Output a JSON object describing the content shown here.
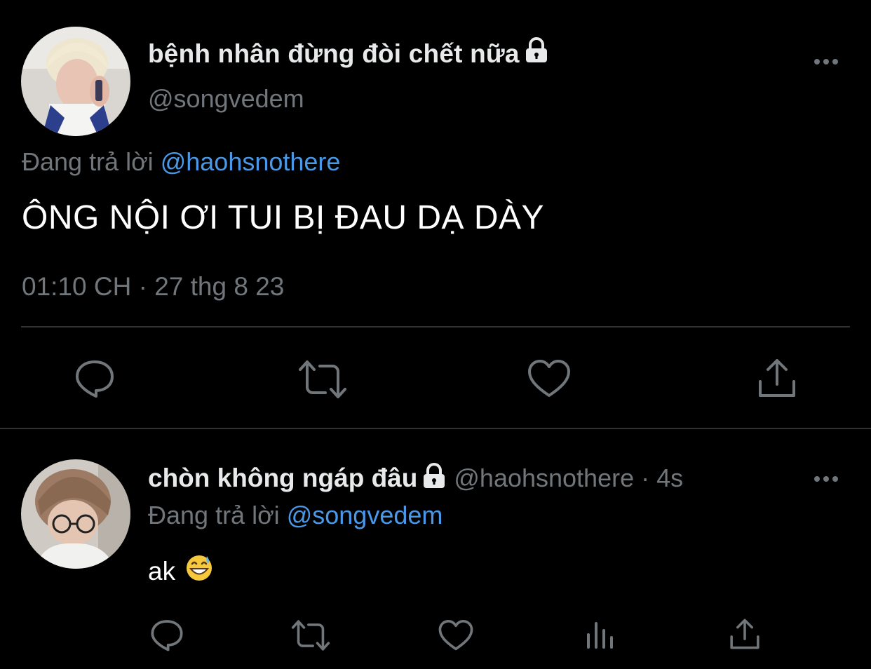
{
  "main_tweet": {
    "display_name": "bệnh nhân đừng đòi chết nữa",
    "handle": "@songvedem",
    "replying_prefix": "Đang trả lời",
    "replying_to": "@haohsnothere",
    "text": "ÔNG NỘI ƠI TUI BỊ ĐAU DẠ DÀY",
    "timestamp": "01:10 CH · 27 thg 8 23",
    "actions": [
      "reply",
      "retweet",
      "like",
      "share"
    ]
  },
  "reply_tweet": {
    "display_name": "chòn không ngáp đâu",
    "handle": "@haohsnothere · 4s",
    "replying_prefix": "Đang trả lời",
    "replying_to": "@songvedem",
    "text": "ak",
    "emoji": "grinning-face-with-sweat",
    "actions": [
      "reply",
      "retweet",
      "like",
      "views",
      "share"
    ]
  },
  "colors": {
    "background": "#000000",
    "primary_text": "#e7e9ea",
    "secondary_text": "#71767b",
    "link": "#4a99e9",
    "divider": "#2f3336"
  }
}
